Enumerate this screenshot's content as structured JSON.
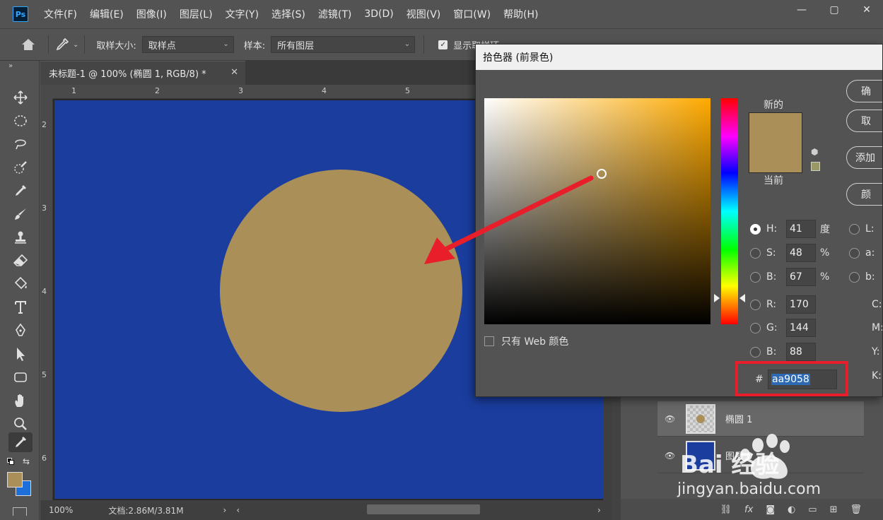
{
  "app": {
    "logo": "Ps"
  },
  "menu": [
    "文件(F)",
    "编辑(E)",
    "图像(I)",
    "图层(L)",
    "文字(Y)",
    "选择(S)",
    "滤镜(T)",
    "3D(D)",
    "视图(V)",
    "窗口(W)",
    "帮助(H)"
  ],
  "window_controls": {
    "minimize": "—",
    "maximize": "▢",
    "close": "✕"
  },
  "options_bar": {
    "sample_size_label": "取样大小:",
    "sample_size_value": "取样点",
    "sample_label": "样本:",
    "sample_value": "所有图层",
    "show_ring_label": "显示取样环"
  },
  "document": {
    "tab_title": "未标题-1 @ 100% (椭圆 1, RGB/8) *",
    "tab_close": "✕",
    "zoom": "100%",
    "doc_info": "文档:2.86M/3.81M",
    "canvas_color": "#1a3d9e",
    "circle_color": "#aa9058"
  },
  "rulers": {
    "top": [
      "1",
      "2",
      "3",
      "4",
      "5"
    ],
    "left": [
      "2",
      "3",
      "4",
      "5",
      "6"
    ]
  },
  "color_picker": {
    "title": "拾色器 (前景色)",
    "new_label": "新的",
    "current_label": "当前",
    "web_only_label": "只有 Web 颜色",
    "buttons": [
      "确",
      "取",
      "添加",
      "颜"
    ],
    "fields": {
      "H": {
        "label": "H:",
        "value": "41",
        "unit": "度"
      },
      "S": {
        "label": "S:",
        "value": "48",
        "unit": "%"
      },
      "Bv": {
        "label": "B:",
        "value": "67",
        "unit": "%"
      },
      "R": {
        "label": "R:",
        "value": "170"
      },
      "G": {
        "label": "G:",
        "value": "144"
      },
      "Bc": {
        "label": "B:",
        "value": "88"
      }
    },
    "lab": {
      "L": "L:",
      "a": "a:",
      "b": "b:"
    },
    "cmyk": {
      "C": "C:",
      "M": "M:",
      "Y": "Y:",
      "K": "K:"
    },
    "hex_hash": "#",
    "hex_value": "aa9058",
    "new_color": "#aa9058",
    "web_safe_color": "#999966"
  },
  "layers": [
    {
      "name": "椭圆 1",
      "selected": true
    },
    {
      "name": "图层 0",
      "selected": false
    }
  ],
  "watermark": {
    "brand": "Bai 经验",
    "url": "jingyan.baidu.com"
  }
}
